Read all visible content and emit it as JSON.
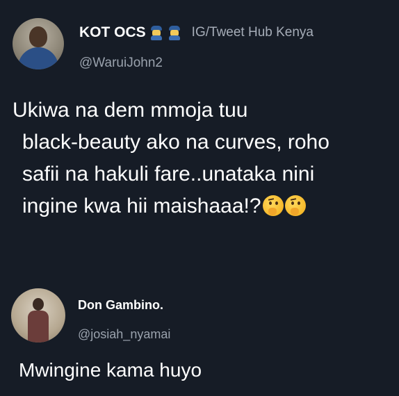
{
  "tweet": {
    "display_name": "KOT OCS",
    "badges": [
      "police-officer-emoji",
      "police-officer-emoji"
    ],
    "source": "IG/Tweet Hub Kenya",
    "handle": "@WaruiJohn2",
    "text_lines": [
      "Ukiwa na dem mmoja tuu",
      "black-beauty ako na curves, roho",
      "safii na hakuli fare..unataka nini",
      "ingine kwa hii maishaaa!?"
    ],
    "trailing_emojis": [
      "thinking-face-emoji",
      "thinking-face-emoji"
    ]
  },
  "reply": {
    "display_name": "Don Gambino.",
    "handle": "@josiah_nyamai",
    "text": "Mwingine kama huyo"
  },
  "colors": {
    "background": "#161c26",
    "text_primary": "#ffffff",
    "text_secondary": "#9aa2ad"
  }
}
